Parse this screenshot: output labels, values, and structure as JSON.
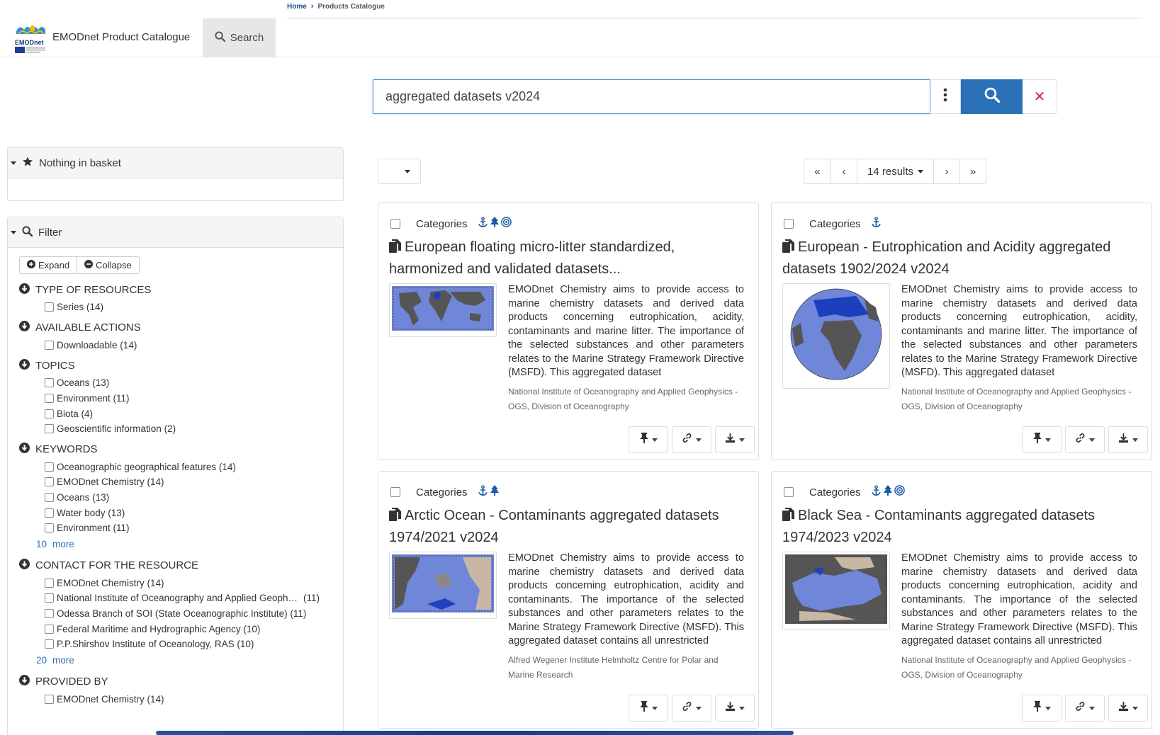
{
  "breadcrumb": {
    "home": "Home",
    "current": "Products Catalogue"
  },
  "header": {
    "title": "EMODnet Product Catalogue",
    "nav_search": "Search",
    "logo_text": "EMODnet"
  },
  "search": {
    "query": "aggregated datasets v2024"
  },
  "basket": {
    "label": "Nothing in basket"
  },
  "filter": {
    "label": "Filter",
    "expand": "Expand",
    "collapse": "Collapse",
    "facets": [
      {
        "title": "TYPE OF RESOURCES",
        "items": [
          "Series (14)"
        ]
      },
      {
        "title": "AVAILABLE ACTIONS",
        "items": [
          "Downloadable (14)"
        ]
      },
      {
        "title": "TOPICS",
        "items": [
          "Oceans (13)",
          "Environment (11)",
          "Biota (4)",
          "Geoscientific information (2)"
        ]
      },
      {
        "title": "KEYWORDS",
        "items": [
          "Oceanographic geographical features (14)",
          "EMODnet Chemistry (14)",
          "Oceans (13)",
          "Water body (13)",
          "Environment (11)"
        ],
        "more_count": "10",
        "more_label": "more"
      },
      {
        "title": "CONTACT FOR THE RESOURCE",
        "items": [
          "EMODnet Chemistry (14)",
          "National Institute of Oceanography and Applied Geoph…",
          "Odessa Branch of SOI (State Oceanographic Institute) (11)",
          "Federal Maritime and Hydrographic Agency (10)",
          "P.P.Shirshov Institute of Oceanology, RAS (10)"
        ],
        "item2_count": "(11)",
        "more_count": "20",
        "more_label": "more"
      },
      {
        "title": "PROVIDED BY",
        "items": [
          "EMODnet Chemistry (14)"
        ]
      }
    ]
  },
  "pager": {
    "results": "14 results"
  },
  "cards": [
    {
      "categories_label": "Categories",
      "title": "European floating micro-litter standardized, harmonized and validated datasets...",
      "description": "EMODnet Chemistry aims to provide access to marine chemistry datasets and derived data products concerning eutrophication, acidity, contaminants and marine litter. The importance of the selected substances and other parameters relates to the Marine Strategy Framework Directive (MSFD). This aggregated dataset",
      "organisation": "National Institute of Oceanography and Applied Geophysics - OGS, Division of Oceanography",
      "icons": [
        "anchor-icon",
        "tree-icon",
        "target-icon"
      ]
    },
    {
      "categories_label": "Categories",
      "title": "European - Eutrophication and Acidity aggregated datasets 1902/2024 v2024",
      "description": "EMODnet Chemistry aims to provide access to marine chemistry datasets and derived data products concerning eutrophication, acidity, contaminants and marine litter. The importance of the selected substances and other parameters relates to the Marine Strategy Framework Directive (MSFD). This aggregated dataset",
      "organisation": "National Institute of Oceanography and Applied Geophysics - OGS, Division of Oceanography",
      "icons": [
        "anchor-icon"
      ]
    },
    {
      "categories_label": "Categories",
      "title": "Arctic Ocean - Contaminants aggregated datasets 1974/2021 v2024",
      "description": "EMODnet Chemistry aims to provide access to marine chemistry datasets and derived data products concerning eutrophication, acidity and contaminants. The importance of the selected substances and other parameters relates to the Marine Strategy Framework Directive (MSFD). This aggregated dataset contains all unrestricted",
      "organisation": "Alfred Wegener Institute Helmholtz Centre for Polar and Marine Research",
      "icons": [
        "anchor-icon",
        "tree-icon"
      ]
    },
    {
      "categories_label": "Categories",
      "title": "Black Sea - Contaminants aggregated datasets 1974/2023 v2024",
      "description": "EMODnet Chemistry aims to provide access to marine chemistry datasets and derived data products concerning eutrophication, acidity and contaminants. The importance of the selected substances and other parameters relates to the Marine Strategy Framework Directive (MSFD). This aggregated dataset contains all unrestricted",
      "organisation": "National Institute of Oceanography and Applied Geophysics - OGS, Division of Oceanography",
      "icons": [
        "anchor-icon",
        "tree-icon",
        "target-icon"
      ]
    }
  ],
  "colors": {
    "accent": "#2a71b8",
    "icon_blue": "#1a5aa8",
    "clear_red": "#c9302c"
  }
}
